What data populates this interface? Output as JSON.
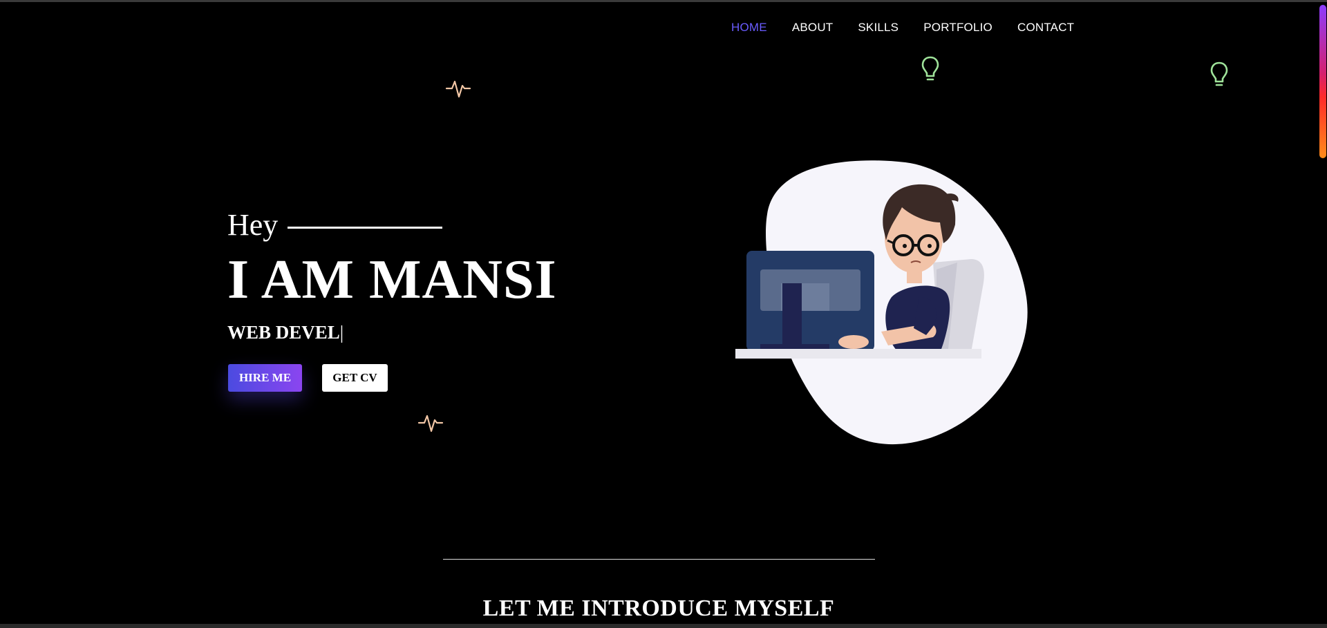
{
  "nav": {
    "items": [
      {
        "label": "HOME",
        "active": true
      },
      {
        "label": "ABOUT",
        "active": false
      },
      {
        "label": "SKILLS",
        "active": false
      },
      {
        "label": "PORTFOLIO",
        "active": false
      },
      {
        "label": "CONTACT",
        "active": false
      }
    ]
  },
  "hero": {
    "greeting": "Hey",
    "name": "I AM MANSI",
    "role_typed": "WEB DEVEL",
    "cursor": "|",
    "hire_button": "HIRE ME",
    "cv_button": "GET CV"
  },
  "about": {
    "title": "LET ME INTRODUCE MYSELF"
  },
  "icons": {
    "pulse": "pulse-icon",
    "bulb": "lightbulb-icon"
  },
  "colors": {
    "background": "#000000",
    "nav_active": "#6a5cff",
    "pulse": "#f3c7a6",
    "bulb": "#9fe39a",
    "hire_gradient_start": "#4b4be0",
    "hire_gradient_end": "#8b45f0"
  }
}
